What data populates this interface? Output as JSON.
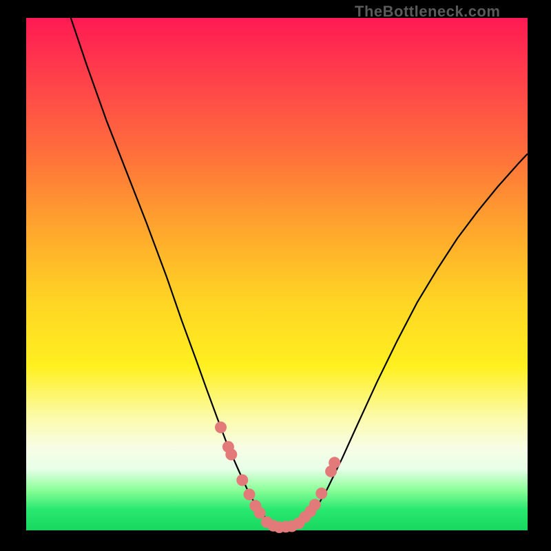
{
  "attribution": "TheBottleneck.com",
  "chart_data": {
    "type": "line",
    "title": "",
    "xlabel": "",
    "ylabel": "",
    "xlim": [
      0,
      100
    ],
    "ylim": [
      0,
      100
    ],
    "grid": false,
    "series": [
      {
        "name": "curve",
        "color": "#000000",
        "x": [
          8.9,
          12,
          16,
          20,
          24,
          28,
          31,
          34,
          36,
          38,
          40,
          42,
          44,
          45.5,
          47,
          49,
          51,
          53,
          55,
          56.5,
          58,
          60,
          63,
          66,
          70,
          74,
          78,
          82,
          86,
          90,
          94,
          98,
          100
        ],
        "y": [
          100,
          91,
          80,
          70,
          60,
          49.5,
          41,
          33,
          27.5,
          22.2,
          17,
          12.5,
          8.2,
          5.4,
          3.2,
          1.3,
          0.6,
          0.6,
          1.5,
          2.8,
          4.6,
          8.0,
          14,
          20.5,
          29,
          37,
          44.5,
          51,
          57,
          62.2,
          67,
          71.4,
          73.5
        ]
      },
      {
        "name": "dots",
        "color": "#e37a7a",
        "x": [
          38.8,
          40.3,
          40.9,
          43.1,
          44.5,
          45.7,
          46.6,
          48.0,
          49.3,
          50.5,
          51.8,
          53.0,
          54.4,
          55.6,
          56.7,
          57.6,
          58.9,
          60.8,
          61.5
        ],
        "y": [
          20.1,
          16.3,
          14.8,
          9.8,
          7.0,
          4.8,
          3.4,
          1.6,
          0.9,
          0.6,
          0.7,
          0.8,
          1.4,
          2.6,
          3.7,
          5.0,
          7.2,
          11.5,
          13.2
        ]
      }
    ]
  }
}
